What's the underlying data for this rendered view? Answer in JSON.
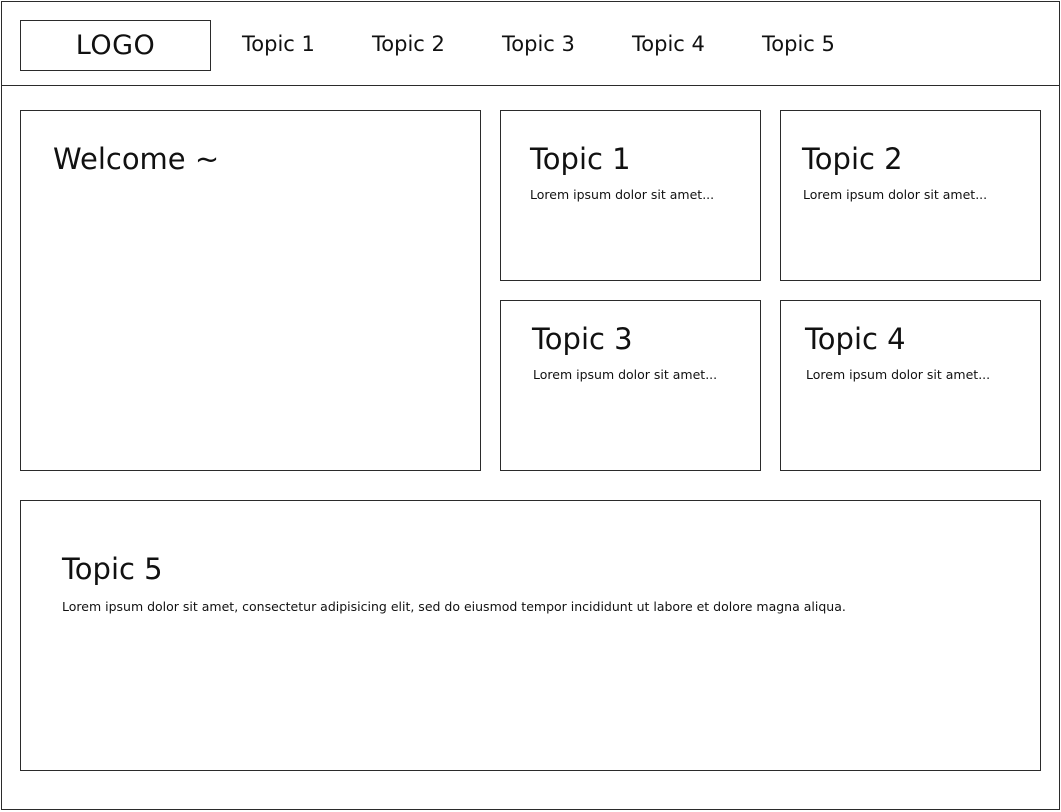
{
  "header": {
    "logo": "LOGO",
    "nav": [
      "Topic 1",
      "Topic 2",
      "Topic 3",
      "Topic 4",
      "Topic 5"
    ]
  },
  "welcome": {
    "title": "Welcome ~"
  },
  "cards": [
    {
      "title": "Topic 1",
      "text": "Lorem ipsum dolor sit amet..."
    },
    {
      "title": "Topic 2",
      "text": "Lorem ipsum dolor sit amet..."
    },
    {
      "title": "Topic 3",
      "text": "Lorem ipsum dolor sit amet..."
    },
    {
      "title": "Topic 4",
      "text": "Lorem ipsum dolor sit amet..."
    }
  ],
  "feature": {
    "title": "Topic 5",
    "text": "Lorem ipsum dolor sit amet, consectetur adipisicing elit, sed do eiusmod tempor incididunt ut labore et dolore magna aliqua."
  }
}
